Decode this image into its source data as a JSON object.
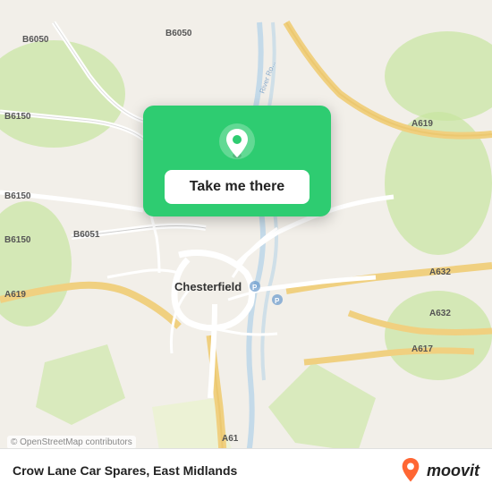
{
  "map": {
    "attribution": "© OpenStreetMap contributors",
    "center": "Chesterfield",
    "region": "East Midlands"
  },
  "popup": {
    "button_label": "Take me there"
  },
  "bottom_bar": {
    "place_name": "Crow Lane Car Spares, East Midlands"
  },
  "moovit": {
    "logo_text": "moovit"
  },
  "roads": {
    "labels": [
      "B6050",
      "B6150",
      "B6150",
      "B6051",
      "A619",
      "A619",
      "A632",
      "A632",
      "A617",
      "A61"
    ]
  }
}
